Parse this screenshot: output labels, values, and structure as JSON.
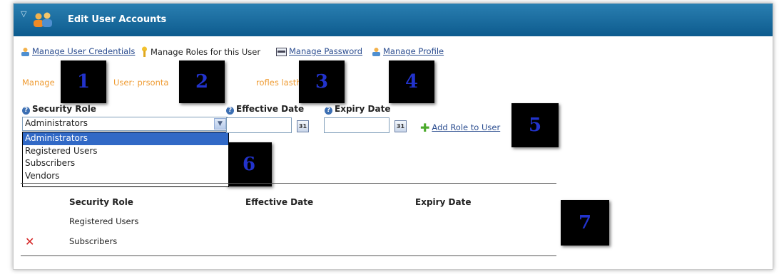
{
  "window": {
    "title": "Edit User Accounts"
  },
  "tabs": [
    {
      "label": "Manage User Credentials",
      "icon": "users-icon",
      "active": false
    },
    {
      "label": "Manage Roles for this User",
      "icon": "key-icon",
      "active": true
    },
    {
      "label": "Manage Password",
      "icon": "password-icon",
      "active": false
    },
    {
      "label": "Manage Profile",
      "icon": "users-icon",
      "active": false
    }
  ],
  "faded_text": {
    "left": "Manage",
    "mid": "User: prsonta",
    "right": "rofles lasthiou"
  },
  "markers": [
    "1",
    "2",
    "3",
    "4",
    "5",
    "6",
    "7"
  ],
  "form": {
    "security_role_label": "Security Role",
    "security_role_value": "Administrators",
    "effective_date_label": "Effective Date",
    "effective_date_value": "",
    "expiry_date_label": "Expiry Date",
    "expiry_date_value": "",
    "calendar_glyph": "31",
    "add_role_label": "Add Role to User"
  },
  "dropdown": {
    "options": [
      "Administrators",
      "Registered Users",
      "Subscribers",
      "Vendors"
    ],
    "selected_index": 0
  },
  "table": {
    "columns": [
      "Security Role",
      "Effective Date",
      "Expiry Date"
    ],
    "rows": [
      {
        "role": "Registered Users",
        "effective": "",
        "expiry": "",
        "deletable": false
      },
      {
        "role": "Subscribers",
        "effective": "",
        "expiry": "",
        "deletable": true
      }
    ],
    "delete_glyph": "✕"
  },
  "colors": {
    "titlebar": "#0d5b8e",
    "link": "#2a4c8f",
    "faded_text": "#ef9c34",
    "marker_bg": "#000000",
    "marker_text": "#2233cc",
    "selected_option": "#3169c6",
    "delete": "#d42020",
    "add": "#4caa2c"
  }
}
